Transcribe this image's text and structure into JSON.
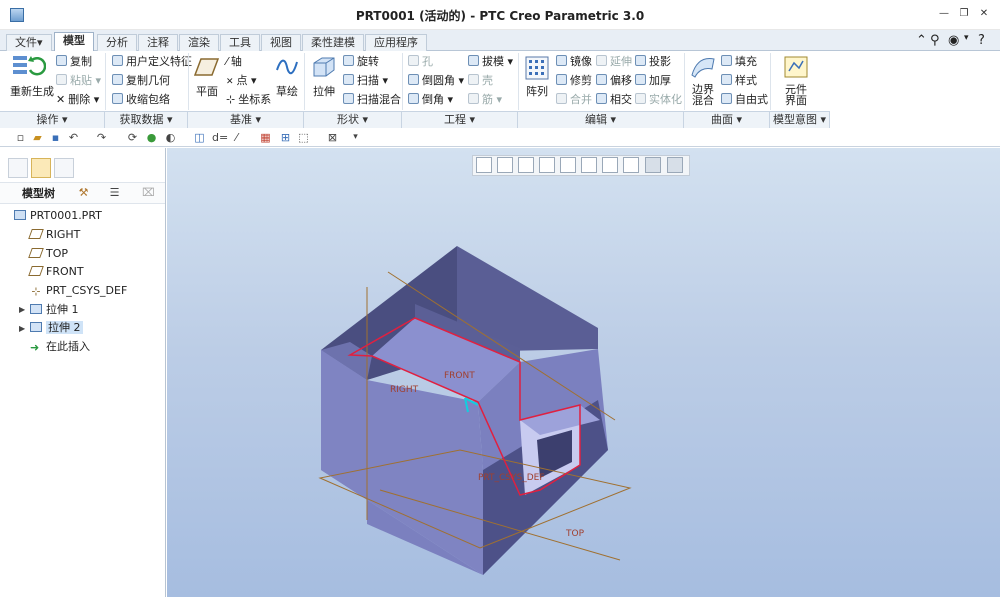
{
  "window": {
    "title": "PRT0001 (活动的) - PTC Creo Parametric 3.0"
  },
  "tabs": [
    {
      "label": "文件",
      "dropdown": "▾"
    },
    {
      "label": "模型"
    },
    {
      "label": "分析"
    },
    {
      "label": "注释"
    },
    {
      "label": "渲染"
    },
    {
      "label": "工具"
    },
    {
      "label": "视图"
    },
    {
      "label": "柔性建模"
    },
    {
      "label": "应用程序"
    }
  ],
  "ribbon": {
    "operations": {
      "regen": "重新生成",
      "copy": "复制",
      "paste": "粘贴",
      "delete": "删除"
    },
    "get_data": {
      "udf": "用户定义特征",
      "copy_geom": "复制几何",
      "shrinkwrap": "收缩包络"
    },
    "datum": {
      "plane": "平面",
      "axis": "轴",
      "point": "点",
      "csys": "坐标系",
      "sketch": "草绘"
    },
    "shapes": {
      "extrude": "拉伸",
      "revolve": "旋转",
      "sweep": "扫描",
      "swept_blend": "扫描混合"
    },
    "engineering": {
      "hole": "孔",
      "round": "倒圆角",
      "chamfer": "倒角",
      "draft": "拔模",
      "shell": "壳",
      "rib": "筋"
    },
    "editing": {
      "pattern": "阵列",
      "mirror": "镜像",
      "trim": "修剪",
      "merge": "合并",
      "extend": "延伸",
      "offset": "偏移",
      "intersect": "相交",
      "project": "投影",
      "thicken": "加厚",
      "solidify": "实体化"
    },
    "surfaces": {
      "boundary": "边界混合",
      "fill": "填充",
      "style": "样式",
      "freestyle": "自由式"
    },
    "intent": {
      "component": "元件界面"
    }
  },
  "groups": [
    "操作",
    "获取数据",
    "基准",
    "形状",
    "工程",
    "编辑",
    "曲面",
    "模型意图"
  ],
  "panel": {
    "tree_title": "模型树"
  },
  "tree": [
    {
      "label": "PRT0001.PRT"
    },
    {
      "label": "RIGHT"
    },
    {
      "label": "TOP"
    },
    {
      "label": "FRONT"
    },
    {
      "label": "PRT_CSYS_DEF"
    },
    {
      "label": "拉伸 1"
    },
    {
      "label": "拉伸 2"
    },
    {
      "label": "在此插入"
    }
  ],
  "viewport": {
    "label_front": "FRONT",
    "label_right": "RIGHT",
    "label_top": "TOP",
    "label_csys": "PRT_CSYS_DEF"
  },
  "colors": {
    "part_fill": "#7b80bf",
    "part_dark": "#4f5385",
    "selection": "#e02040",
    "datum": "#a07030",
    "viewport_bg": "#bccde6"
  }
}
